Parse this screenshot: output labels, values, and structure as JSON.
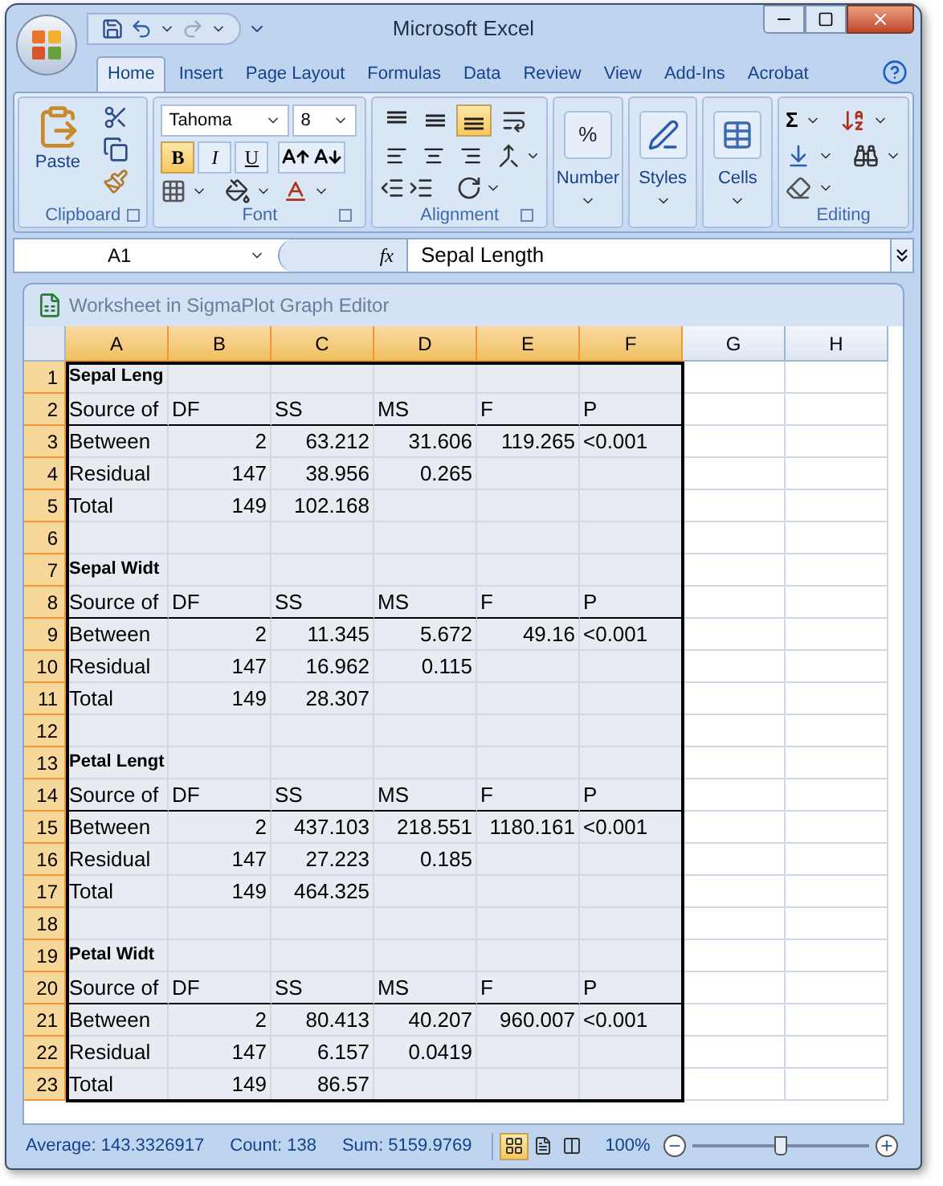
{
  "window": {
    "title": "Microsoft Excel"
  },
  "ribbon_tabs": [
    {
      "label": "Home",
      "selected": true
    },
    {
      "label": "Insert",
      "selected": false
    },
    {
      "label": "Page Layout",
      "selected": false
    },
    {
      "label": "Formulas",
      "selected": false
    },
    {
      "label": "Data",
      "selected": false
    },
    {
      "label": "Review",
      "selected": false
    },
    {
      "label": "View",
      "selected": false
    },
    {
      "label": "Add-Ins",
      "selected": false
    },
    {
      "label": "Acrobat",
      "selected": false
    }
  ],
  "clipboard": {
    "paste_label": "Paste",
    "group_label": "Clipboard"
  },
  "font": {
    "font_name": "Tahoma",
    "font_size": "8",
    "group_label": "Font",
    "styles": [
      {
        "label": "B",
        "kind": "bold",
        "selected": true
      },
      {
        "label": "I",
        "kind": "italic",
        "selected": false
      },
      {
        "label": "U",
        "kind": "underline",
        "selected": false
      }
    ]
  },
  "alignment": {
    "group_label": "Alignment",
    "vertical": [
      {
        "kind": "top",
        "selected": false
      },
      {
        "kind": "middle",
        "selected": false
      },
      {
        "kind": "bottom",
        "selected": true
      }
    ],
    "horizontal": [
      {
        "kind": "left",
        "selected": false
      },
      {
        "kind": "center",
        "selected": false
      },
      {
        "kind": "right",
        "selected": false
      }
    ]
  },
  "big_groups": [
    {
      "label": "Number",
      "kind": "number",
      "symbol": "%"
    },
    {
      "label": "Styles",
      "kind": "styles"
    },
    {
      "label": "Cells",
      "kind": "cells"
    }
  ],
  "editing": {
    "group_label": "Editing",
    "sum_symbol": "Σ"
  },
  "formula_bar": {
    "name_box": "A1",
    "fx": "fx",
    "formula": "Sepal Length"
  },
  "sheet_window": {
    "title": "Worksheet in SigmaPlot Graph Editor"
  },
  "columns": [
    {
      "label": "A",
      "selected": true
    },
    {
      "label": "B",
      "selected": true
    },
    {
      "label": "C",
      "selected": true
    },
    {
      "label": "D",
      "selected": true
    },
    {
      "label": "E",
      "selected": true
    },
    {
      "label": "F",
      "selected": true
    },
    {
      "label": "G",
      "selected": false
    },
    {
      "label": "H",
      "selected": false
    }
  ],
  "rows": [
    {
      "number": "1",
      "kind": "title",
      "selected": true,
      "cells": [
        "Sepal Leng"
      ]
    },
    {
      "number": "2",
      "kind": "header",
      "selected": true,
      "cells": [
        "Source of",
        "DF",
        "SS",
        "MS",
        "F",
        "P"
      ]
    },
    {
      "number": "3",
      "kind": "data",
      "selected": true,
      "cells": [
        "Between",
        "2",
        "63.212",
        "31.606",
        "119.265",
        "<0.001"
      ]
    },
    {
      "number": "4",
      "kind": "data",
      "selected": true,
      "cells": [
        "Residual",
        "147",
        "38.956",
        "0.265"
      ]
    },
    {
      "number": "5",
      "kind": "data",
      "selected": true,
      "cells": [
        "Total",
        "149",
        "102.168"
      ]
    },
    {
      "number": "6",
      "kind": "blank",
      "selected": true,
      "cells": []
    },
    {
      "number": "7",
      "kind": "title",
      "selected": true,
      "cells": [
        "Sepal Widt"
      ]
    },
    {
      "number": "8",
      "kind": "header",
      "selected": true,
      "cells": [
        "Source of",
        "DF",
        "SS",
        "MS",
        "F",
        "P"
      ]
    },
    {
      "number": "9",
      "kind": "data",
      "selected": true,
      "cells": [
        "Between",
        "2",
        "11.345",
        "5.672",
        "49.16",
        "<0.001"
      ]
    },
    {
      "number": "10",
      "kind": "data",
      "selected": true,
      "cells": [
        "Residual",
        "147",
        "16.962",
        "0.115"
      ]
    },
    {
      "number": "11",
      "kind": "data",
      "selected": true,
      "cells": [
        "Total",
        "149",
        "28.307"
      ]
    },
    {
      "number": "12",
      "kind": "blank",
      "selected": true,
      "cells": []
    },
    {
      "number": "13",
      "kind": "title",
      "selected": true,
      "cells": [
        "Petal Lengt"
      ]
    },
    {
      "number": "14",
      "kind": "header",
      "selected": true,
      "cells": [
        "Source of",
        "DF",
        "SS",
        "MS",
        "F",
        "P"
      ]
    },
    {
      "number": "15",
      "kind": "data",
      "selected": true,
      "cells": [
        "Between",
        "2",
        "437.103",
        "218.551",
        "1180.161",
        "<0.001"
      ]
    },
    {
      "number": "16",
      "kind": "data",
      "selected": true,
      "cells": [
        "Residual",
        "147",
        "27.223",
        "0.185"
      ]
    },
    {
      "number": "17",
      "kind": "data",
      "selected": true,
      "cells": [
        "Total",
        "149",
        "464.325"
      ]
    },
    {
      "number": "18",
      "kind": "blank",
      "selected": true,
      "cells": []
    },
    {
      "number": "19",
      "kind": "title",
      "selected": true,
      "cells": [
        "Petal Widt"
      ]
    },
    {
      "number": "20",
      "kind": "header",
      "selected": true,
      "cells": [
        "Source of",
        "DF",
        "SS",
        "MS",
        "F",
        "P"
      ]
    },
    {
      "number": "21",
      "kind": "data",
      "selected": true,
      "cells": [
        "Between",
        "2",
        "80.413",
        "40.207",
        "960.007",
        "<0.001"
      ]
    },
    {
      "number": "22",
      "kind": "data",
      "selected": true,
      "cells": [
        "Residual",
        "147",
        "6.157",
        "0.0419"
      ]
    },
    {
      "number": "23",
      "kind": "data",
      "selected": true,
      "cells": [
        "Total",
        "149",
        "86.57"
      ]
    }
  ],
  "status_bar": {
    "average": "Average: 143.3326917",
    "count": "Count: 138",
    "sum": "Sum: 5159.9769",
    "views": [
      {
        "kind": "normal",
        "selected": true
      },
      {
        "kind": "page_layout",
        "selected": false
      },
      {
        "kind": "page_break",
        "selected": false
      }
    ],
    "zoom": "100%",
    "zoom_slider": {
      "level": 0.5
    }
  }
}
